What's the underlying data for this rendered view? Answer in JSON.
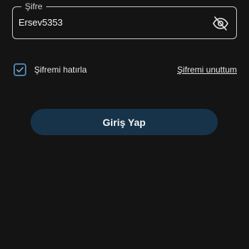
{
  "password_field": {
    "label": "Şifre",
    "value": "Ersev5353",
    "visibility_icon": "eye-off-icon"
  },
  "remember": {
    "label": "Şifremi hatırla",
    "checked": true,
    "check_icon": "check-icon"
  },
  "forgot_link": "Şifremi unuttum",
  "login_button": "Giriş Yap",
  "colors": {
    "background": "#141414",
    "button": "#17334a",
    "checkbox": "#4f7fa6"
  }
}
